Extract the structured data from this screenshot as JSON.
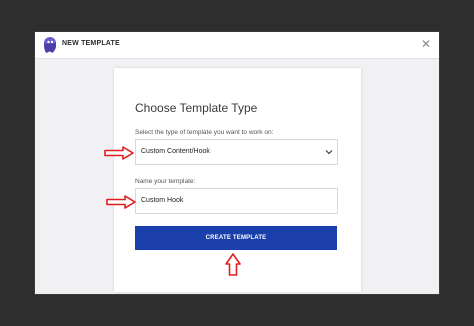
{
  "modal": {
    "title": "NEW TEMPLATE",
    "close_glyph": "✕",
    "logo_icon": "ghost-logo-icon"
  },
  "card": {
    "heading": "Choose Template Type",
    "type_label": "Select the type of template you want to work on:",
    "type_value": "Custom Content/Hook",
    "name_label": "Name your template:",
    "name_value": "Custom Hook",
    "create_label": "CREATE TEMPLATE"
  },
  "colors": {
    "backdrop": "#2e2e2e",
    "button": "#1a3faa",
    "annotation_arrow": "#e01e1e"
  }
}
